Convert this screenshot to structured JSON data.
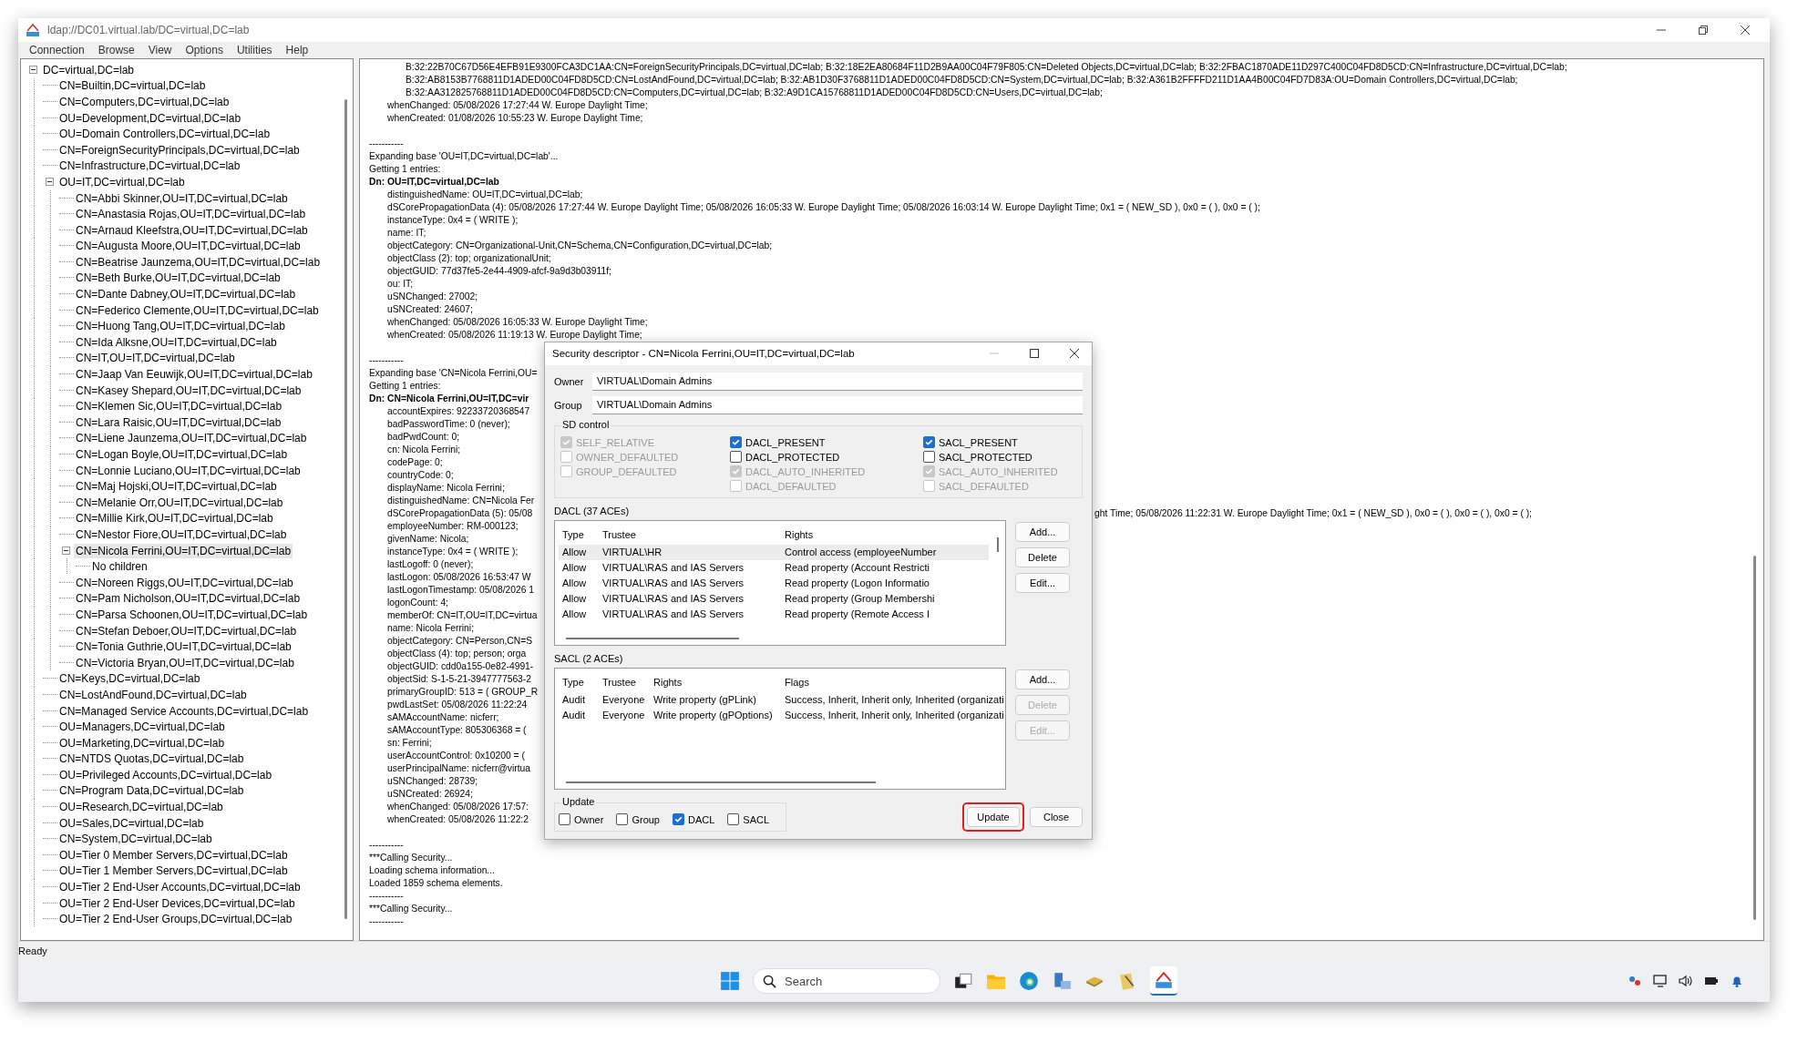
{
  "window": {
    "title": "ldap://DC01.virtual.lab/DC=virtual,DC=lab"
  },
  "menu": [
    "Connection",
    "Browse",
    "View",
    "Options",
    "Utilities",
    "Help"
  ],
  "tree": {
    "label": "DC=virtual,DC=lab",
    "expanded": true,
    "selected": false,
    "children": [
      {
        "label": "CN=Builtin,DC=virtual,DC=lab",
        "selected": false
      },
      {
        "label": "CN=Computers,DC=virtual,DC=lab",
        "selected": false
      },
      {
        "label": "OU=Development,DC=virtual,DC=lab",
        "selected": false
      },
      {
        "label": "OU=Domain Controllers,DC=virtual,DC=lab",
        "selected": false
      },
      {
        "label": "CN=ForeignSecurityPrincipals,DC=virtual,DC=lab",
        "selected": false
      },
      {
        "label": "CN=Infrastructure,DC=virtual,DC=lab",
        "selected": false
      },
      {
        "label": "OU=IT,DC=virtual,DC=lab",
        "expanded": true,
        "selected": false,
        "children": [
          {
            "label": "CN=Abbi Skinner,OU=IT,DC=virtual,DC=lab",
            "selected": false
          },
          {
            "label": "CN=Anastasia Rojas,OU=IT,DC=virtual,DC=lab",
            "selected": false
          },
          {
            "label": "CN=Arnaud Kleefstra,OU=IT,DC=virtual,DC=lab",
            "selected": false
          },
          {
            "label": "CN=Augusta Moore,OU=IT,DC=virtual,DC=lab",
            "selected": false
          },
          {
            "label": "CN=Beatrise Jaunzema,OU=IT,DC=virtual,DC=lab",
            "selected": false
          },
          {
            "label": "CN=Beth Burke,OU=IT,DC=virtual,DC=lab",
            "selected": false
          },
          {
            "label": "CN=Dante Dabney,OU=IT,DC=virtual,DC=lab",
            "selected": false
          },
          {
            "label": "CN=Federico Clemente,OU=IT,DC=virtual,DC=lab",
            "selected": false
          },
          {
            "label": "CN=Huong Tang,OU=IT,DC=virtual,DC=lab",
            "selected": false
          },
          {
            "label": "CN=Ida Alksne,OU=IT,DC=virtual,DC=lab",
            "selected": false
          },
          {
            "label": "CN=IT,OU=IT,DC=virtual,DC=lab",
            "selected": false
          },
          {
            "label": "CN=Jaap Van Eeuwijk,OU=IT,DC=virtual,DC=lab",
            "selected": false
          },
          {
            "label": "CN=Kasey Shepard,OU=IT,DC=virtual,DC=lab",
            "selected": false
          },
          {
            "label": "CN=Klemen Sic,OU=IT,DC=virtual,DC=lab",
            "selected": false
          },
          {
            "label": "CN=Lara Raisic,OU=IT,DC=virtual,DC=lab",
            "selected": false
          },
          {
            "label": "CN=Liene Jaunzema,OU=IT,DC=virtual,DC=lab",
            "selected": false
          },
          {
            "label": "CN=Logan Boyle,OU=IT,DC=virtual,DC=lab",
            "selected": false
          },
          {
            "label": "CN=Lonnie Luciano,OU=IT,DC=virtual,DC=lab",
            "selected": false
          },
          {
            "label": "CN=Maj Hojski,OU=IT,DC=virtual,DC=lab",
            "selected": false
          },
          {
            "label": "CN=Melanie Orr,OU=IT,DC=virtual,DC=lab",
            "selected": false
          },
          {
            "label": "CN=Millie Kirk,OU=IT,DC=virtual,DC=lab",
            "selected": false
          },
          {
            "label": "CN=Nestor Fiore,OU=IT,DC=virtual,DC=lab",
            "selected": false
          },
          {
            "label": "CN=Nicola Ferrini,OU=IT,DC=virtual,DC=lab",
            "expanded": true,
            "selected": true,
            "children": [
              {
                "label": "No children",
                "selected": false
              }
            ]
          },
          {
            "label": "CN=Noreen Riggs,OU=IT,DC=virtual,DC=lab",
            "selected": false
          },
          {
            "label": "CN=Pam Nicholson,OU=IT,DC=virtual,DC=lab",
            "selected": false
          },
          {
            "label": "CN=Parsa Schoonen,OU=IT,DC=virtual,DC=lab",
            "selected": false
          },
          {
            "label": "CN=Stefan Deboer,OU=IT,DC=virtual,DC=lab",
            "selected": false
          },
          {
            "label": "CN=Tonia Guthrie,OU=IT,DC=virtual,DC=lab",
            "selected": false
          },
          {
            "label": "CN=Victoria Bryan,OU=IT,DC=virtual,DC=lab",
            "selected": false
          }
        ]
      },
      {
        "label": "CN=Keys,DC=virtual,DC=lab",
        "selected": false
      },
      {
        "label": "CN=LostAndFound,DC=virtual,DC=lab",
        "selected": false
      },
      {
        "label": "CN=Managed Service Accounts,DC=virtual,DC=lab",
        "selected": false
      },
      {
        "label": "OU=Managers,DC=virtual,DC=lab",
        "selected": false
      },
      {
        "label": "OU=Marketing,DC=virtual,DC=lab",
        "selected": false
      },
      {
        "label": "CN=NTDS Quotas,DC=virtual,DC=lab",
        "selected": false
      },
      {
        "label": "OU=Privileged Accounts,DC=virtual,DC=lab",
        "selected": false
      },
      {
        "label": "CN=Program Data,DC=virtual,DC=lab",
        "selected": false
      },
      {
        "label": "OU=Research,DC=virtual,DC=lab",
        "selected": false
      },
      {
        "label": "OU=Sales,DC=virtual,DC=lab",
        "selected": false
      },
      {
        "label": "CN=System,DC=virtual,DC=lab",
        "selected": false
      },
      {
        "label": "OU=Tier 0 Member Servers,DC=virtual,DC=lab",
        "selected": false
      },
      {
        "label": "OU=Tier 1 Member Servers,DC=virtual,DC=lab",
        "selected": false
      },
      {
        "label": "OU=Tier 2 End-User Accounts,DC=virtual,DC=lab",
        "selected": false
      },
      {
        "label": "OU=Tier 2 End-User Devices,DC=virtual,DC=lab",
        "selected": false
      },
      {
        "label": "OU=Tier 2 End-User Groups,DC=virtual,DC=lab",
        "selected": false
      }
    ]
  },
  "log": [
    {
      "kind": "cont",
      "text": "B:32:22B70C67D56E4EFB91E9300FCA3DC1AA:CN=ForeignSecurityPrincipals,DC=virtual,DC=lab; B:32:18E2EA80684F11D2B9AA00C04F79F805:CN=Deleted Objects,DC=virtual,DC=lab; B:32:2FBAC1870ADE11D297C400C04FD8D5CD:CN=Infrastructure,DC=virtual,DC=lab;"
    },
    {
      "kind": "cont",
      "text": "B:32:AB8153B7768811D1ADED00C04FD8D5CD:CN=LostAndFound,DC=virtual,DC=lab; B:32:AB1D30F3768811D1ADED00C04FD8D5CD:CN=System,DC=virtual,DC=lab; B:32:A361B2FFFFD211D1AA4B00C04FD7D83A:OU=Domain Controllers,DC=virtual,DC=lab;"
    },
    {
      "kind": "cont",
      "text": "B:32:AA312825768811D1ADED00C04FD8D5CD:CN=Computers,DC=virtual,DC=lab; B:32:A9D1CA15768811D1ADED00C04FD8D5CD:CN=Users,DC=virtual,DC=lab;"
    },
    {
      "kind": "attr",
      "text": "whenChanged: 05/08/2026 17:27:44 W. Europe Daylight Time;"
    },
    {
      "kind": "attr",
      "text": "whenCreated: 01/08/2026 10:55:23 W. Europe Daylight Time;"
    },
    {
      "kind": "gap"
    },
    {
      "kind": "plain",
      "text": "-----------"
    },
    {
      "kind": "plain",
      "text": "Expanding base 'OU=IT,DC=virtual,DC=lab'..."
    },
    {
      "kind": "plain",
      "text": "Getting 1 entries:"
    },
    {
      "kind": "bold",
      "text": "Dn: OU=IT,DC=virtual,DC=lab"
    },
    {
      "kind": "attr",
      "text": "distinguishedName: OU=IT,DC=virtual,DC=lab;"
    },
    {
      "kind": "attr",
      "text": "dSCorePropagationData (4): 05/08/2026 17:27:44 W. Europe Daylight Time; 05/08/2026 16:05:33 W. Europe Daylight Time; 05/08/2026 16:03:14 W. Europe Daylight Time; 0x1 = ( NEW_SD ), 0x0 = (  ), 0x0 = (  );"
    },
    {
      "kind": "attr",
      "text": "instanceType: 0x4 = ( WRITE );"
    },
    {
      "kind": "attr",
      "text": "name: IT;"
    },
    {
      "kind": "attr",
      "text": "objectCategory: CN=Organizational-Unit,CN=Schema,CN=Configuration,DC=virtual,DC=lab;"
    },
    {
      "kind": "attr",
      "text": "objectClass (2): top; organizationalUnit;"
    },
    {
      "kind": "attr",
      "text": "objectGUID: 77d37fe5-2e44-4909-afcf-9a9d3b03911f;"
    },
    {
      "kind": "attr",
      "text": "ou: IT;"
    },
    {
      "kind": "attr",
      "text": "uSNChanged: 27002;"
    },
    {
      "kind": "attr",
      "text": "uSNCreated: 24607;"
    },
    {
      "kind": "attr",
      "text": "whenChanged: 05/08/2026 16:05:33 W. Europe Daylight Time;"
    },
    {
      "kind": "attr",
      "text": "whenCreated: 05/08/2026 11:19:13 W. Europe Daylight Time;"
    },
    {
      "kind": "gap"
    },
    {
      "kind": "plain",
      "text": "-----------"
    },
    {
      "kind": "plain",
      "text": "Expanding base 'CN=Nicola Ferrini,OU="
    },
    {
      "kind": "plain",
      "text": "Getting 1 entries:"
    },
    {
      "kind": "bold",
      "text": "Dn: CN=Nicola Ferrini,OU=IT,DC=vir"
    },
    {
      "kind": "attr",
      "text": "accountExpires: 92233720368547"
    },
    {
      "kind": "attr",
      "text": "badPasswordTime: 0 (never);"
    },
    {
      "kind": "attr",
      "text": "badPwdCount: 0;"
    },
    {
      "kind": "attr",
      "text": "cn: Nicola Ferrini;"
    },
    {
      "kind": "attr",
      "text": "codePage: 0;"
    },
    {
      "kind": "attr",
      "text": "countryCode: 0;"
    },
    {
      "kind": "attr",
      "text": "displayName: Nicola Ferrini;"
    },
    {
      "kind": "attr",
      "text": "distinguishedName: CN=Nicola Fer"
    },
    {
      "kind": "split",
      "text": "dSCorePropagationData (5): 05/08",
      "text_right": "ght Time; 05/08/2026 11:22:31 W. Europe Daylight Time; 0x1 = ( NEW_SD ), 0x0 = (  ), 0x0 = (  ), 0x0 = (  );"
    },
    {
      "kind": "attr",
      "text": "employeeNumber: RM-000123;"
    },
    {
      "kind": "attr",
      "text": "givenName: Nicola;"
    },
    {
      "kind": "attr",
      "text": "instanceType: 0x4 = ( WRITE );"
    },
    {
      "kind": "attr",
      "text": "lastLogoff: 0 (never);"
    },
    {
      "kind": "attr",
      "text": "lastLogon: 05/08/2026 16:53:47 W"
    },
    {
      "kind": "attr",
      "text": "lastLogonTimestamp: 05/08/2026 1"
    },
    {
      "kind": "attr",
      "text": "logonCount: 4;"
    },
    {
      "kind": "attr",
      "text": "memberOf: CN=IT,OU=IT,DC=virtua"
    },
    {
      "kind": "attr",
      "text": "name: Nicola Ferrini;"
    },
    {
      "kind": "attr",
      "text": "objectCategory: CN=Person,CN=S"
    },
    {
      "kind": "attr",
      "text": "objectClass (4): top; person; orga"
    },
    {
      "kind": "attr",
      "text": "objectGUID: cdd0a155-0e82-4991-"
    },
    {
      "kind": "attr",
      "text": "objectSid: S-1-5-21-3947777563-2"
    },
    {
      "kind": "attr",
      "text": "primaryGroupID: 513 = ( GROUP_R"
    },
    {
      "kind": "attr",
      "text": "pwdLastSet: 05/08/2026 11:22:24"
    },
    {
      "kind": "attr",
      "text": "sAMAccountName: nicferr;"
    },
    {
      "kind": "attr",
      "text": "sAMAccountType: 805306368 = ("
    },
    {
      "kind": "attr",
      "text": "sn: Ferrini;"
    },
    {
      "kind": "attr",
      "text": "userAccountControl: 0x10200 = ("
    },
    {
      "kind": "attr",
      "text": "userPrincipalName: nicferr@virtua"
    },
    {
      "kind": "attr",
      "text": "uSNChanged: 28739;"
    },
    {
      "kind": "attr",
      "text": "uSNCreated: 26924;"
    },
    {
      "kind": "attr",
      "text": "whenChanged: 05/08/2026 17:57:"
    },
    {
      "kind": "attr",
      "text": "whenCreated: 05/08/2026 11:22:2"
    },
    {
      "kind": "gap"
    },
    {
      "kind": "plain",
      "text": "-----------"
    },
    {
      "kind": "plain",
      "text": "***Calling Security..."
    },
    {
      "kind": "plain",
      "text": "Loading schema information..."
    },
    {
      "kind": "plain",
      "text": "Loaded 1859 schema elements."
    },
    {
      "kind": "plain",
      "text": "-----------"
    },
    {
      "kind": "plain",
      "text": "***Calling Security..."
    },
    {
      "kind": "plain",
      "text": "-----------"
    }
  ],
  "dialog": {
    "title": "Security descriptor - CN=Nicola Ferrini,OU=IT,DC=virtual,DC=lab",
    "owner": {
      "label": "Owner",
      "value": "VIRTUAL\\Domain Admins"
    },
    "group": {
      "label": "Group",
      "value": "VIRTUAL\\Domain Admins"
    },
    "sd_control": {
      "title": "SD control",
      "columns": [
        [
          {
            "label": "SELF_RELATIVE",
            "checked": true,
            "disabled": true
          },
          {
            "label": "OWNER_DEFAULTED",
            "checked": false,
            "disabled": true
          },
          {
            "label": "GROUP_DEFAULTED",
            "checked": false,
            "disabled": true
          }
        ],
        [
          {
            "label": "DACL_PRESENT",
            "checked": true,
            "disabled": false
          },
          {
            "label": "DACL_PROTECTED",
            "checked": false,
            "disabled": false
          },
          {
            "label": "DACL_AUTO_INHERITED",
            "checked": true,
            "disabled": true
          },
          {
            "label": "DACL_DEFAULTED",
            "checked": false,
            "disabled": true
          }
        ],
        [
          {
            "label": "SACL_PRESENT",
            "checked": true,
            "disabled": false
          },
          {
            "label": "SACL_PROTECTED",
            "checked": false,
            "disabled": false
          },
          {
            "label": "SACL_AUTO_INHERITED",
            "checked": true,
            "disabled": true
          },
          {
            "label": "SACL_DEFAULTED",
            "checked": false,
            "disabled": true
          }
        ]
      ]
    },
    "dacl": {
      "title": "DACL (37 ACEs)",
      "columns": [
        "Type",
        "Trustee",
        "Rights"
      ],
      "rows": [
        {
          "cells": [
            "Allow",
            "VIRTUAL\\HR",
            "Control access (employeeNumber"
          ],
          "selected": true
        },
        {
          "cells": [
            "Allow",
            "VIRTUAL\\RAS and IAS Servers",
            "Read property (Account Restricti"
          ],
          "selected": false
        },
        {
          "cells": [
            "Allow",
            "VIRTUAL\\RAS and IAS Servers",
            "Read property (Logon Informatio"
          ],
          "selected": false
        },
        {
          "cells": [
            "Allow",
            "VIRTUAL\\RAS and IAS Servers",
            "Read property (Group Membershi"
          ],
          "selected": false
        },
        {
          "cells": [
            "Allow",
            "VIRTUAL\\RAS and IAS Servers",
            "Read property (Remote Access I"
          ],
          "selected": false
        }
      ],
      "buttons": [
        {
          "label": "Add...",
          "disabled": false
        },
        {
          "label": "Delete",
          "disabled": false
        },
        {
          "label": "Edit...",
          "disabled": false
        }
      ]
    },
    "sacl": {
      "title": "SACL (2 ACEs)",
      "columns": [
        "Type",
        "Trustee",
        "Rights",
        "Flags"
      ],
      "rows": [
        {
          "cells": [
            "Audit",
            "Everyone",
            "Write property (gPLink)",
            "Success, Inherit, Inherit only, Inherited (organizati"
          ],
          "selected": false
        },
        {
          "cells": [
            "Audit",
            "Everyone",
            "Write property (gPOptions)",
            "Success, Inherit, Inherit only, Inherited (organizati"
          ],
          "selected": false
        }
      ],
      "buttons": [
        {
          "label": "Add...",
          "disabled": false
        },
        {
          "label": "Delete",
          "disabled": true
        },
        {
          "label": "Edit...",
          "disabled": true
        }
      ]
    },
    "update": {
      "title": "Update",
      "options": [
        {
          "label": "Owner",
          "checked": false
        },
        {
          "label": "Group",
          "checked": false
        },
        {
          "label": "DACL",
          "checked": true
        },
        {
          "label": "SACL",
          "checked": false
        }
      ]
    },
    "buttons": [
      {
        "label": "Update",
        "highlighted": true
      },
      {
        "label": "Close",
        "highlighted": false
      }
    ]
  },
  "status_bar": "Ready",
  "taskbar": {
    "search": {
      "placeholder": "Search"
    }
  }
}
